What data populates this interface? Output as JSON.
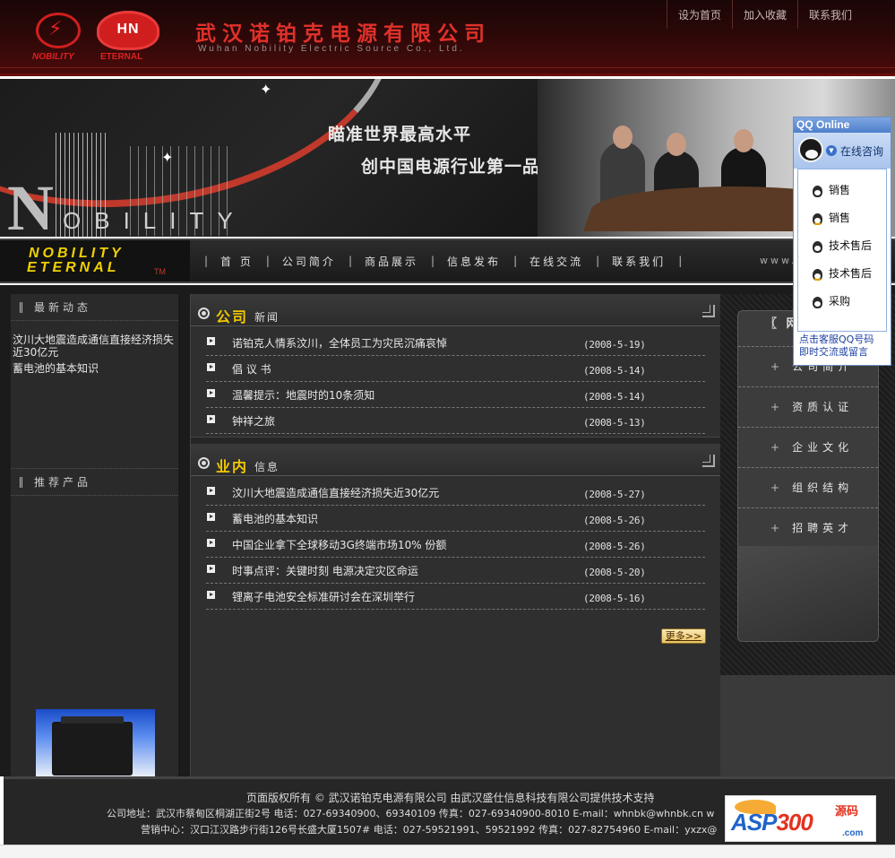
{
  "header": {
    "logo_left_text": "NOBILITY",
    "logo_right_mark": "HN",
    "logo_right_text": "ETERNAL",
    "company_cn": "武汉诺铂克电源有限公司",
    "company_en": "Wuhan Nobility Electric Source Co., Ltd.",
    "top_links": [
      "设为首页",
      "加入收藏",
      "联系我们"
    ]
  },
  "banner": {
    "slogan_line1": "瞄准世界最高水平",
    "slogan_line2": "创中国电源行业第一品牌",
    "brand_initial": "N",
    "brand_rest": "OBILITY"
  },
  "nav": {
    "logo_line1": "NOBILITY",
    "logo_line2": "ETERNAL",
    "logo_tm": "TM",
    "items": [
      "首 页",
      "公司简介",
      "商品展示",
      "信息发布",
      "在线交流",
      "联系我们"
    ],
    "www": "www."
  },
  "left": {
    "latest_title": "最新动态",
    "latest_items": [
      "汶川大地震造成通信直接经济损失近30亿元",
      "蓄电池的基本知识"
    ],
    "recommend_title": "推荐产品"
  },
  "company_news": {
    "heading_highlight": "公司",
    "heading_rest": "新闻",
    "items": [
      {
        "title": "诺铂克人情系汶川，全体员工为灾民沉痛哀悼",
        "date": "(2008-5-19)"
      },
      {
        "title": "倡 议 书",
        "date": "(2008-5-14)"
      },
      {
        "title": "温馨提示：地震时的10条须知",
        "date": "(2008-5-14)"
      },
      {
        "title": "钟祥之旅",
        "date": "(2008-5-13)"
      }
    ]
  },
  "industry_news": {
    "heading_highlight": "业内",
    "heading_rest": "信息",
    "items": [
      {
        "title": "汶川大地震造成通信直接经济损失近30亿元",
        "date": "(2008-5-27)"
      },
      {
        "title": "蓄电池的基本知识",
        "date": "(2008-5-26)"
      },
      {
        "title": "中国企业拿下全球移动3G终端市场10% 份额",
        "date": "(2008-5-26)"
      },
      {
        "title": "时事点评：关键时刻 电源决定灾区命运",
        "date": "(2008-5-20)"
      },
      {
        "title": "锂离子电池安全标准研讨会在深圳举行",
        "date": "(2008-5-16)"
      }
    ],
    "more_label": "更多>>"
  },
  "right_panel": {
    "heading": "〖 网",
    "items": [
      "公司简介",
      "资质认证",
      "企业文化",
      "组织结构",
      "招聘英才"
    ]
  },
  "qq": {
    "title": "QQ Online",
    "consult_label": "在线咨询",
    "contacts": [
      "销售",
      "销售",
      "技术售后",
      "技术售后",
      "采购"
    ],
    "footer_line1": "点击客服QQ号码",
    "footer_line2": "即时交流或留言"
  },
  "footer": {
    "line1": "页面版权所有 © 武汉诺铂克电源有限公司    由武汉盛仕信息科技有限公司提供技术支持",
    "line2": "公司地址：武汉市蔡甸区桐湖正街2号   电话：027-69340900、69340109  传真：027-69340900-8010   E-mail：whnbk@whnbk.cn   w",
    "line3": "营销中心：汉口江汉路步行街126号长盛大厦1507#  电话：027-59521991、59521992  传真：027-82754960   E-mail：yxzx@"
  },
  "watermark": {
    "text_blue": "ASP",
    "text_red": "300",
    "text_cn": "源码",
    "domain": ".com"
  }
}
